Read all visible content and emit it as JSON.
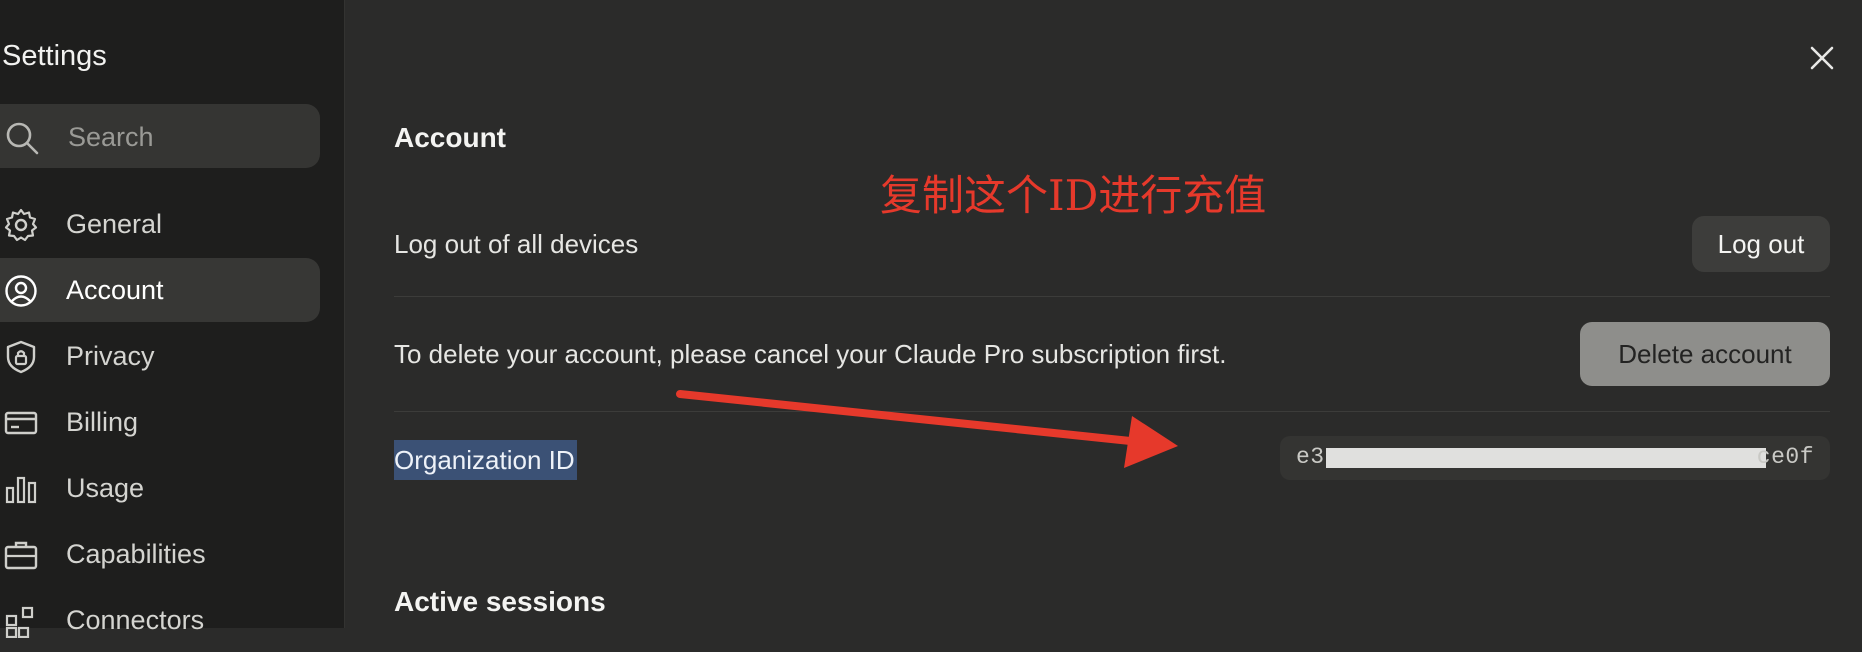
{
  "sidebar": {
    "title": "Settings",
    "search": {
      "placeholder": "Search",
      "value": ""
    },
    "items": [
      {
        "label": "General",
        "icon": "gear-icon"
      },
      {
        "label": "Account",
        "icon": "user-circle-icon",
        "active": true
      },
      {
        "label": "Privacy",
        "icon": "shield-lock-icon"
      },
      {
        "label": "Billing",
        "icon": "credit-card-icon"
      },
      {
        "label": "Usage",
        "icon": "bar-chart-icon"
      },
      {
        "label": "Capabilities",
        "icon": "briefcase-icon"
      },
      {
        "label": "Connectors",
        "icon": "blocks-icon"
      }
    ]
  },
  "main": {
    "account_title": "Account",
    "logout_row": {
      "text": "Log out of all devices",
      "button": "Log out"
    },
    "delete_row": {
      "text": "To delete your account, please cancel your Claude Pro subscription first.",
      "button": "Delete account"
    },
    "org_row": {
      "label": "Organization ID",
      "id_start": "e3",
      "id_end": "ce0f"
    },
    "sessions_title": "Active sessions"
  },
  "annotation": {
    "text": "复制这个ID进行充值",
    "color": "#e6392b"
  },
  "colors": {
    "background": "#2b2b2a",
    "sidebar": "#1e1e1d",
    "selection_highlight": "#3b5175"
  }
}
